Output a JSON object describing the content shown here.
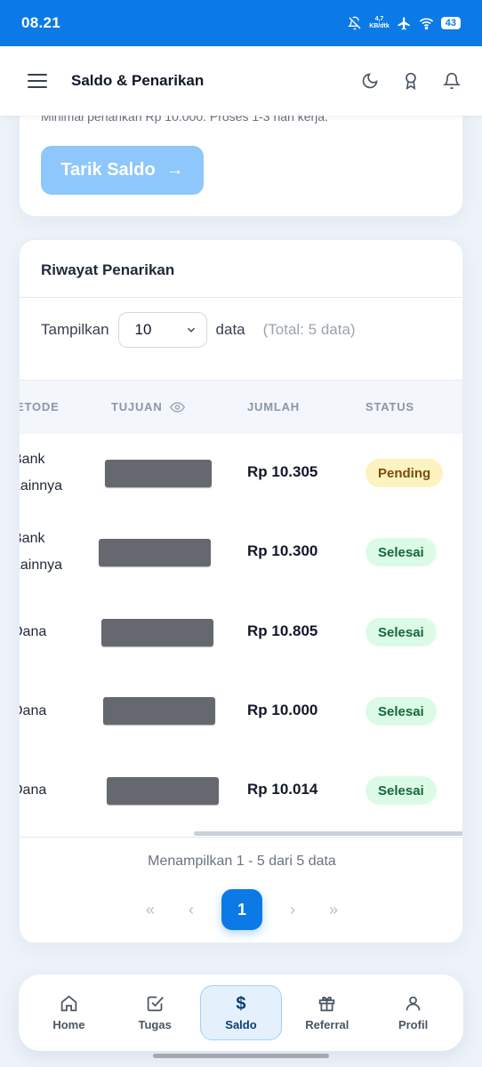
{
  "status_bar": {
    "time": "08.21",
    "net_speed": "4,7",
    "net_unit": "KB/dtk",
    "battery": "43"
  },
  "app_bar": {
    "title": "Saldo & Penarikan"
  },
  "withdraw_card": {
    "note": "Minimal penarikan Rp 10.000. Proses 1-3 hari kerja.",
    "button_label": "Tarik Saldo",
    "button_arrow": "→"
  },
  "history": {
    "title": "Riwayat Penarikan",
    "show_label": "Tampilkan",
    "page_size": "10",
    "data_label": "data",
    "total_label": "(Total: 5 data)",
    "columns": {
      "method": "ETODE",
      "dest": "TUJUAN",
      "amount": "JUMLAH",
      "status": "STATUS"
    },
    "rows": [
      {
        "method_line1": "Bank",
        "method_line2": "Lainnya",
        "amount": "Rp 10.305",
        "status": "Pending"
      },
      {
        "method_line1": "Bank",
        "method_line2": "Lainnya",
        "amount": "Rp 10.300",
        "status": "Selesai"
      },
      {
        "method_line1": "Dana",
        "method_line2": "",
        "amount": "Rp 10.805",
        "status": "Selesai"
      },
      {
        "method_line1": "Dana",
        "method_line2": "",
        "amount": "Rp 10.000",
        "status": "Selesai"
      },
      {
        "method_line1": "Dana",
        "method_line2": "",
        "amount": "Rp 10.014",
        "status": "Selesai"
      }
    ],
    "pagination_info": "Menampilkan 1 - 5 dari 5 data",
    "pager": {
      "first": "«",
      "prev": "‹",
      "current": "1",
      "next": "›",
      "last": "»"
    }
  },
  "bottom_nav": {
    "items": [
      {
        "label": "Home",
        "icon": "home-icon"
      },
      {
        "label": "Tugas",
        "icon": "task-check-icon"
      },
      {
        "label": "Saldo",
        "icon": "dollar-icon",
        "active": true
      },
      {
        "label": "Referral",
        "icon": "gift-icon"
      },
      {
        "label": "Profil",
        "icon": "user-icon"
      }
    ],
    "saldo_glyph": "$"
  },
  "colors": {
    "primary": "#0b7ae6",
    "button_disabled": "#8ec7fb",
    "pending_bg": "#fdf3c0",
    "done_bg": "#dcfbe7"
  }
}
